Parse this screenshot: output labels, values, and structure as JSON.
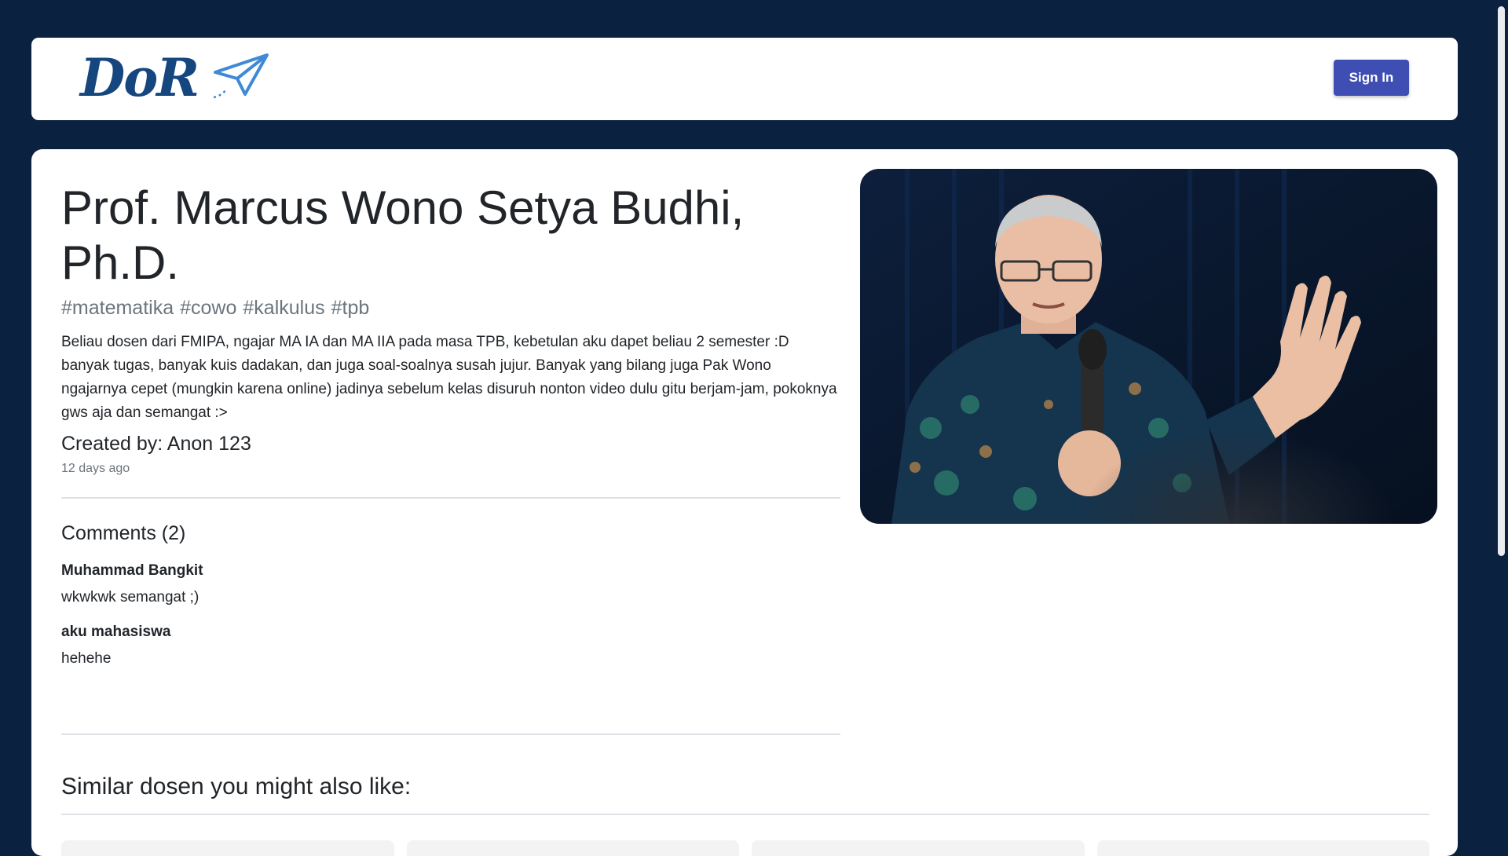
{
  "header": {
    "logo_text": "DoR",
    "signin_label": "Sign In"
  },
  "dosen": {
    "name": "Prof. Marcus Wono Setya Budhi, Ph.D.",
    "tags": [
      "#matematika",
      "#cowo",
      "#kalkulus",
      "#tpb"
    ],
    "description": "Beliau dosen dari FMIPA, ngajar MA IA dan MA IIA pada masa TPB, kebetulan aku dapet beliau 2 semester :D banyak tugas, banyak kuis dadakan, dan juga soal-soalnya susah jujur. Banyak yang bilang juga Pak Wono ngajarnya cepet (mungkin karena online) jadinya sebelum kelas disuruh nonton video dulu gitu berjam-jam, pokoknya gws aja dan semangat :>",
    "created_by": "Created by: Anon 123",
    "time_ago": "12 days ago"
  },
  "comments": {
    "title": "Comments (2)",
    "items": [
      {
        "author": "Muhammad Bangkit",
        "text": "wkwkwk semangat ;)"
      },
      {
        "author": "aku mahasiswa",
        "text": "hehehe"
      }
    ]
  },
  "similar": {
    "title": "Similar dosen you might also like:"
  },
  "colors": {
    "background": "#0b2140",
    "logo": "#16467e",
    "signin_button": "#3e4eb3"
  },
  "icons": {
    "logo_plane": "paper-plane-icon"
  }
}
